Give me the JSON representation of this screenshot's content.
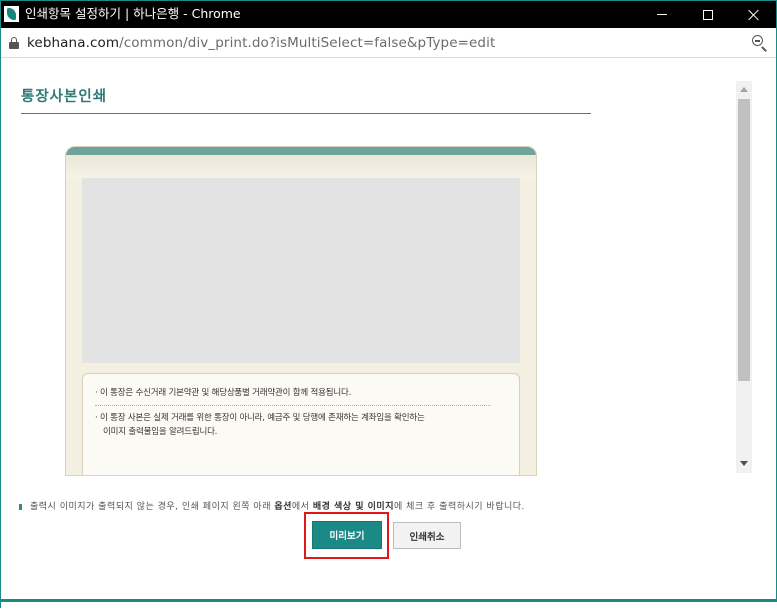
{
  "window": {
    "title": "인쇄항목 설정하기 | 하나은행 - Chrome",
    "icons": [
      "hana-bank-icon",
      "minimize-icon",
      "maximize-icon",
      "close-icon"
    ]
  },
  "addressbar": {
    "url_host": "kebhana.com",
    "url_path": "/common/div_print.do?isMultiSelect=false&pType=edit",
    "icons": [
      "lock-icon",
      "zoom-out-icon"
    ]
  },
  "page": {
    "title": "통장사본인쇄"
  },
  "notice": {
    "line1": "· 이 통장은 수신거래 기본약관 및 해당상품별 거래약관이 함께 적용됩니다.",
    "line2": "· 이 통장 사본은 실제 거래를 위한 통장이 아니라, 예금주 및 당행에 존재하는 계좌임을 확인하는",
    "line3": "이미지 출력물임을 알려드립니다."
  },
  "footer": {
    "note_prefix": "출력시 이미지가 출력되지 않는 경우, 인쇄 페이지 왼쪽 아래 ",
    "note_option": "옵션",
    "note_middle": "에서 ",
    "note_bg": "배경 색상 및 이미지",
    "note_suffix": "에 체크 후 출력하시기 바랍니다."
  },
  "buttons": {
    "preview": "미리보기",
    "cancel": "인쇄취소"
  },
  "colors": {
    "accent": "#1b8a86",
    "title": "#2d7a77",
    "highlight": "#e01818"
  }
}
